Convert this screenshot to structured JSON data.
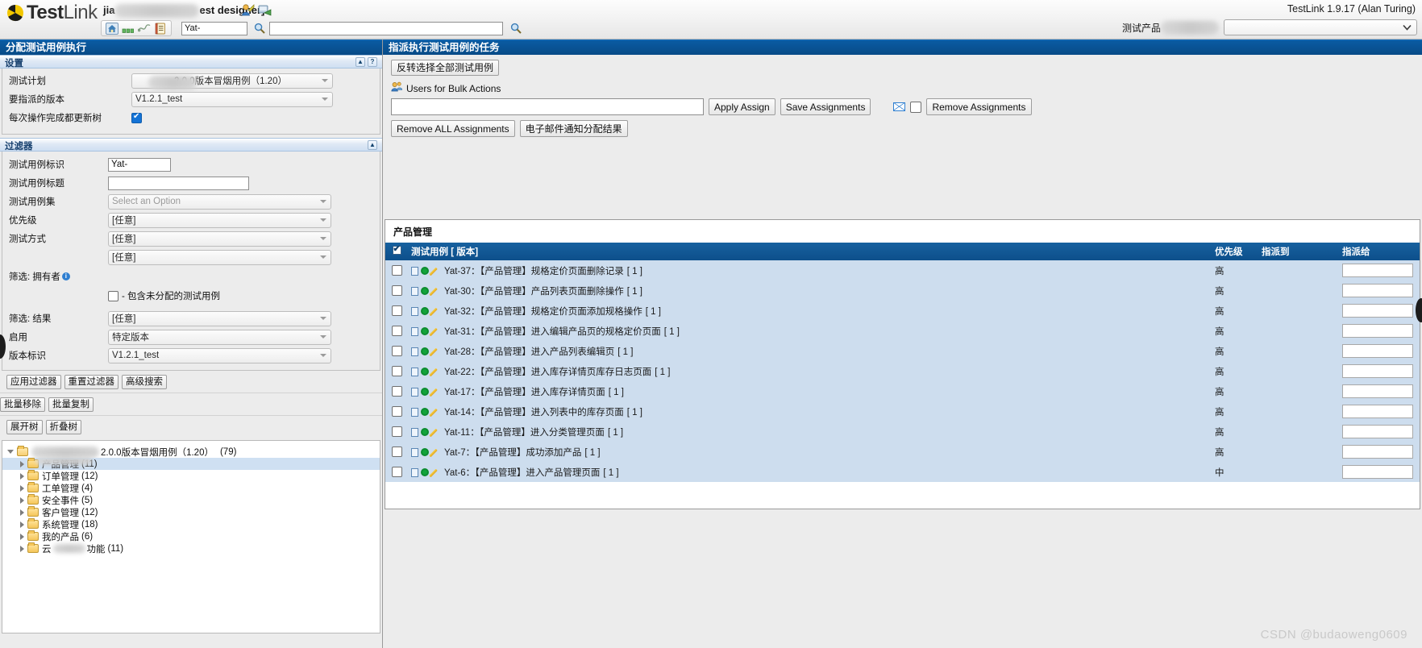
{
  "header": {
    "logo_text_bold": "Test",
    "logo_text_light": "Link",
    "user_prefix": "jia",
    "user_suffix": "est designer]",
    "version": "TestLink 1.9.17 (Alan Turing)",
    "toolbar": {
      "icons": [
        "home-icon",
        "chart-icon",
        "graph-icon",
        "notes-icon"
      ],
      "prefix_value": "Yat-",
      "search_value": "",
      "search_placeholder": ""
    },
    "product_label": "测试产品",
    "product_selected": ""
  },
  "left": {
    "panel_title": "分配测试用例执行",
    "settings": {
      "title": "设置",
      "collapse_icon": "collapse-icon",
      "help_icon": "help-icon",
      "rows": [
        {
          "label": "测试计划",
          "value": "2.0.0版本冒烟用例（1.20）",
          "type": "select",
          "blurred": true
        },
        {
          "label": "要指派的版本",
          "value": "V1.2.1_test",
          "type": "select",
          "blurred": false
        }
      ],
      "update_tree_label": "每次操作完成都更新树",
      "update_tree_checked": true
    },
    "filters": {
      "title": "过滤器",
      "collapse_icon": "collapse-icon",
      "rows": [
        {
          "label": "测试用例标识",
          "value": "Yat-",
          "type": "text",
          "width": 78
        },
        {
          "label": "测试用例标题",
          "value": "",
          "type": "text",
          "width": 175
        },
        {
          "label": "测试用例集",
          "value": "Select an Option",
          "type": "select",
          "placeholder": true
        },
        {
          "label": "优先级",
          "value": "[任意]",
          "type": "select"
        },
        {
          "label": "测试方式",
          "value": "[任意]",
          "type": "select"
        },
        {
          "label": "",
          "value": "[任意]",
          "type": "select"
        },
        {
          "label": "筛选: 拥有者",
          "value": "",
          "type": "owner-info"
        },
        {
          "label": "",
          "value": "- 包含未分配的测试用例",
          "type": "checkbox",
          "checked": false
        },
        {
          "label": "筛选: 结果",
          "value": "[任意]",
          "type": "select"
        },
        {
          "label": "启用",
          "value": "特定版本",
          "type": "select"
        },
        {
          "label": "版本标识",
          "value": "V1.2.1_test",
          "type": "select"
        }
      ],
      "buttons": [
        "应用过滤器",
        "重置过滤器",
        "高级搜索"
      ]
    },
    "bulk_buttons": [
      "批量移除",
      "批量复制"
    ],
    "tree_buttons": [
      "展开树",
      "折叠树"
    ],
    "tree": {
      "root": {
        "label_blur": true,
        "label": "2.0.0版本冒烟用例（1.20）",
        "count": "(79)",
        "expanded": true
      },
      "nodes": [
        {
          "label": "产品管理",
          "count": "(11)",
          "selected": true,
          "blurred_overlay": true
        },
        {
          "label": "订单管理",
          "count": "(12)",
          "selected": false
        },
        {
          "label": "工单管理",
          "count": "(4)",
          "selected": false
        },
        {
          "label": "安全事件",
          "count": "(5)",
          "selected": false
        },
        {
          "label": "客户管理",
          "count": "(12)",
          "selected": false
        },
        {
          "label": "系统管理",
          "count": "(18)",
          "selected": false
        },
        {
          "label": "我的产品",
          "count": "(6)",
          "selected": false
        },
        {
          "label": "云",
          "label_tail": "功能",
          "count": "(11)",
          "selected": false,
          "blurred_mid": true
        }
      ]
    }
  },
  "right": {
    "panel_title": "指派执行测试用例的任务",
    "invert_button": "反转选择全部测试用例",
    "users_icon": "users-icon",
    "users_label": "Users for Bulk Actions",
    "users_input_value": "",
    "apply_assign_button": "Apply Assign",
    "save_assignments_button": "Save Assignments",
    "mail_icon": "mail-icon",
    "mail_checkbox_checked": false,
    "remove_assignments_button": "Remove Assignments",
    "remove_all_button": "Remove ALL Assignments",
    "email_notify_button": "电子邮件通知分配结果",
    "results": {
      "group_title": "产品管理",
      "header_checkbox_checked": true,
      "columns": [
        "测试用例 [ 版本]",
        "优先级",
        "指派到",
        "指派给"
      ],
      "rows": [
        {
          "checked": false,
          "id": "Yat-37",
          "title": "【产品管理】规格定价页面删除记录",
          "version": "[ 1 ]",
          "priority": "高",
          "assigned_to": "",
          "assign_to_value": ""
        },
        {
          "checked": false,
          "id": "Yat-30",
          "title": "【产品管理】产品列表页面删除操作",
          "version": "[ 1 ]",
          "priority": "高",
          "assigned_to": "",
          "assign_to_value": ""
        },
        {
          "checked": false,
          "id": "Yat-32",
          "title": "【产品管理】规格定价页面添加规格操作",
          "version": "[ 1 ]",
          "priority": "高",
          "assigned_to": "",
          "assign_to_value": ""
        },
        {
          "checked": false,
          "id": "Yat-31",
          "title": "【产品管理】进入编辑产品页的规格定价页面",
          "version": "[ 1 ]",
          "priority": "高",
          "assigned_to": "",
          "assign_to_value": ""
        },
        {
          "checked": false,
          "id": "Yat-28",
          "title": "【产品管理】进入产品列表编辑页",
          "version": "[ 1 ]",
          "priority": "高",
          "assigned_to": "",
          "assign_to_value": ""
        },
        {
          "checked": false,
          "id": "Yat-22",
          "title": "【产品管理】进入库存详情页库存日志页面",
          "version": "[ 1 ]",
          "priority": "高",
          "assigned_to": "",
          "assign_to_value": ""
        },
        {
          "checked": false,
          "id": "Yat-17",
          "title": "【产品管理】进入库存详情页面",
          "version": "[ 1 ]",
          "priority": "高",
          "assigned_to": "",
          "assign_to_value": ""
        },
        {
          "checked": false,
          "id": "Yat-14",
          "title": "【产品管理】进入列表中的库存页面",
          "version": "[ 1 ]",
          "priority": "高",
          "assigned_to": "",
          "assign_to_value": ""
        },
        {
          "checked": false,
          "id": "Yat-11",
          "title": "【产品管理】进入分类管理页面",
          "version": "[ 1 ]",
          "priority": "高",
          "assigned_to": "",
          "assign_to_value": ""
        },
        {
          "checked": false,
          "id": "Yat-7",
          "title": "【产品管理】成功添加产品",
          "version": "[ 1 ]",
          "priority": "高",
          "assigned_to": "",
          "assign_to_value": ""
        },
        {
          "checked": false,
          "id": "Yat-6",
          "title": "【产品管理】进入产品管理页面",
          "version": "[ 1 ]",
          "priority": "中",
          "assigned_to": "",
          "assign_to_value": ""
        }
      ]
    }
  },
  "watermark": "CSDN @budaoweng0609",
  "colors": {
    "panel_title_bg": "#0a5ba3",
    "table_header_bg": "#0d4f8b",
    "row_bg": "#cdddee",
    "selected_tree_row": "#cfe0f2",
    "accent_blue": "#1473d6"
  }
}
